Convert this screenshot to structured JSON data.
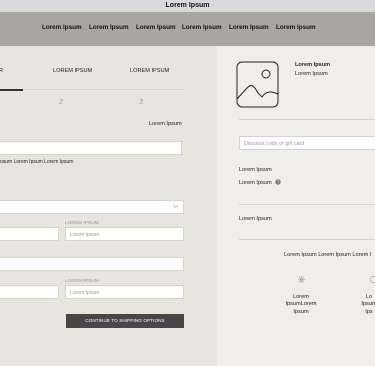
{
  "topbar": {
    "title": "Lorem Ipsum"
  },
  "nav": {
    "items": [
      "Lorem Ipsum",
      "Lorem Ipsum",
      "Lorem Ipsum",
      "Lorem Ipsum",
      "Lorem Ipsum",
      "Lorem Ipsum"
    ]
  },
  "steps": {
    "tabs": [
      "R",
      "LOREM IPSUM",
      "LOREM IPSUM"
    ],
    "numbers": [
      "2",
      "3"
    ]
  },
  "form": {
    "label_right": "Lorem Ipsum",
    "helper_text": "osum Lorem Ipsum Lorem Ipsum",
    "field_label_1": "LOREM IPSUM",
    "placeholder_1": "Lorem Ipsum",
    "field_label_2": "LOREM IPSUM",
    "placeholder_2": "Lorem Ipsum",
    "continue_button": "CONTINUE TO SHIPPING OPTIONS"
  },
  "summary": {
    "product_name": "Lorem Ipsum",
    "product_variant": "Lorem Ipsum",
    "discount_placeholder": "Discount code or gift card",
    "row1": "Lorem Ipsum",
    "row2": "Lorem Ipsum",
    "row3": "Lorem Ipsum",
    "promo_text": "Lorem Ipsum Lorem Ipsum Lorem I",
    "feature_1": "Lorem IpsumLorem Ipsum",
    "feature_2": "Lo Ipsum Ips"
  },
  "icons": [
    "image-placeholder-icon",
    "chevron-down-icon",
    "question-icon",
    "feature-icon"
  ]
}
